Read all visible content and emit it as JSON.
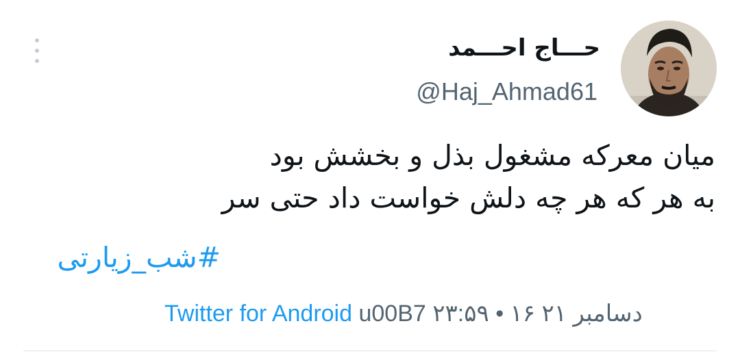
{
  "tweet": {
    "author": {
      "display_name": "حـــاج احـــمد",
      "handle": "@Haj_Ahmad61",
      "avatar_icon": "portrait-photo"
    },
    "more_icon": "vertical-ellipsis-icon",
    "text_lines": [
      "میان معرکه مشغول بذل و بخشش بود",
      "به هر که هر چه دلش خواست داد حتی سر"
    ],
    "hashtag": "#شب_زیارتی",
    "timestamp": "۲۳:۵۹ • ۱۶ دسامبر ۲۱",
    "separator": "u00B7",
    "source": "Twitter for Android",
    "colors": {
      "text": "#0f1419",
      "secondary": "#536471",
      "link": "#1d9bf0",
      "divider": "#dfe6ea"
    }
  }
}
